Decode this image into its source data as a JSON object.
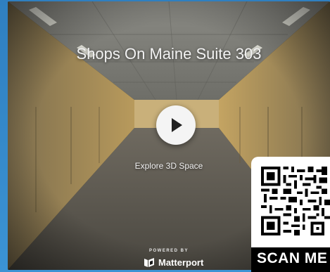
{
  "tour": {
    "title": "Shops On Maine Suite 303",
    "explore_label": "Explore 3D Space",
    "play_icon": "play-icon"
  },
  "branding": {
    "powered_by": "POWERED BY",
    "name": "Matterport",
    "logo_icon": "matterport-logo-icon"
  },
  "qr": {
    "cta": "SCAN ME",
    "icon": "qr-code-icon"
  },
  "colors": {
    "page_background": "#3a8fcf",
    "card": "#ffffff",
    "scan_bar": "#000000",
    "play_button": "#f4f4f4"
  }
}
